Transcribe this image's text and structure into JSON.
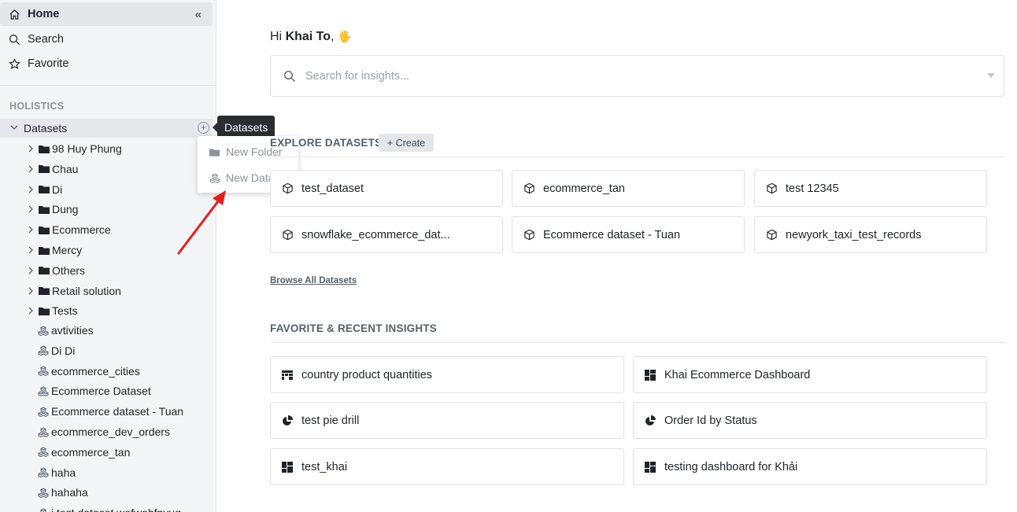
{
  "sidebar": {
    "home": "Home",
    "collapse": "«",
    "search": "Search",
    "favorite": "Favorite",
    "section": "HOLISTICS",
    "datasets_label": "Datasets",
    "folders": [
      "98 Huy Phung",
      "Chau",
      "Di",
      "Dung",
      "Ecommerce",
      "Mercy",
      "Others",
      "Retail solution",
      "Tests"
    ],
    "datasets": [
      "avtivities",
      "Di Di",
      "ecommerce_cities",
      "Ecommerce Dataset",
      "Ecommerce dataset - Tuan",
      "ecommerce_dev_orders",
      "ecommerce_tan",
      "haha",
      "hahaha",
      "i test dataset wefwebfnyug"
    ]
  },
  "tooltip": "Datasets",
  "menu": {
    "new_folder": "New Folder",
    "new_dataset": "New Dataset"
  },
  "main": {
    "greeting_prefix": "Hi ",
    "user_name": "Khai To",
    "greeting_suffix": ",",
    "wave": "🖐",
    "search_placeholder": "Search for insights...",
    "explore_heading": "EXPLORE DATASETS",
    "create_label": "+ Create",
    "datasets": [
      "test_dataset",
      "ecommerce_tan",
      "test 12345",
      "snowflake_ecommerce_dat...",
      "Ecommerce dataset - Tuan",
      "newyork_taxi_test_records"
    ],
    "browse_all": "Browse All Datasets",
    "insights_heading": "FAVORITE & RECENT INSIGHTS",
    "insights": [
      {
        "label": "country product quantities",
        "icon": "pivot-table-icon"
      },
      {
        "label": "Khai Ecommerce Dashboard",
        "icon": "dashboard-icon"
      },
      {
        "label": "test pie drill",
        "icon": "pie-chart-icon"
      },
      {
        "label": "Order Id by Status",
        "icon": "pie-chart-icon"
      },
      {
        "label": "test_khai",
        "icon": "dashboard-icon"
      },
      {
        "label": "testing dashboard for Khải",
        "icon": "dashboard-icon"
      }
    ]
  },
  "colors": {
    "sidebar_bg": "#f4f5f7",
    "tooltip_bg": "#2b2d31",
    "annotation_arrow": "#e02020"
  }
}
